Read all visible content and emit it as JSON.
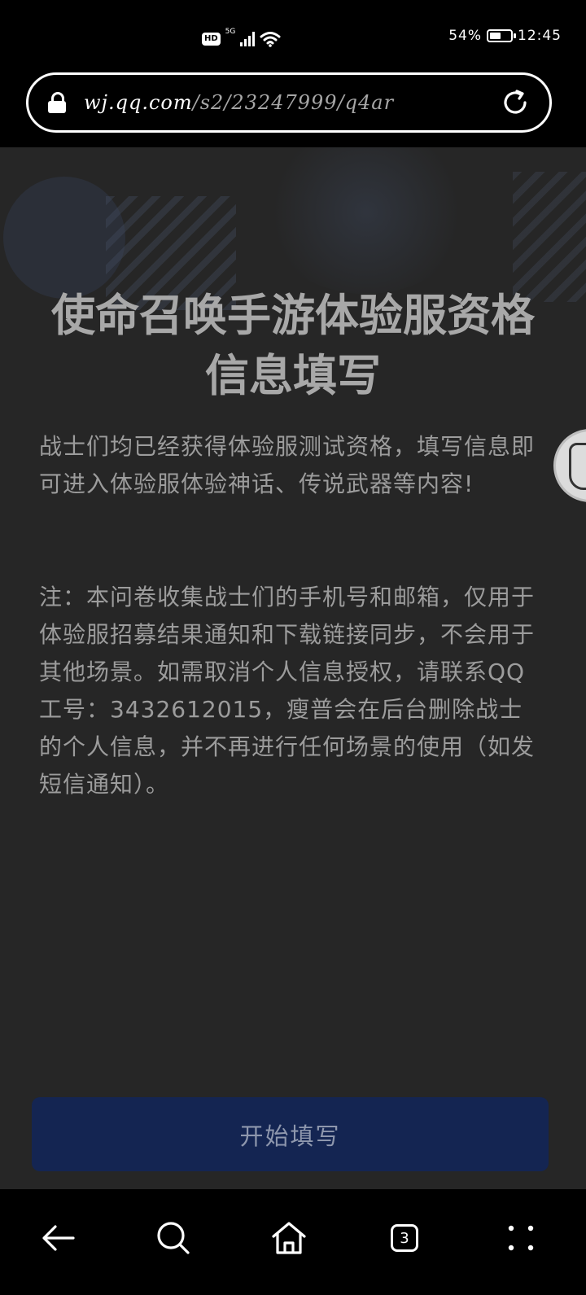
{
  "status_bar": {
    "hd": "HD",
    "network": "5G",
    "battery_text": "54%",
    "battery_level": 0.54,
    "time": "12:45"
  },
  "browser": {
    "url_host": "wj.qq.com",
    "url_path": "/s2/23247999/q4ar",
    "tab_count": "3"
  },
  "page": {
    "title_line1": "使命召唤手游体验服资格",
    "title_line2": "信息填写",
    "intro": "战士们均已经获得体验服测试资格，填写信息即可进入体验服体验神话、传说武器等内容!",
    "note": "注：本问卷收集战士们的手机号和邮箱，仅用于体验服招募结果通知和下载链接同步，不会用于其他场景。如需取消个人信息授权，请联系QQ工号：3432612015，瘦普会在后台删除战士的个人信息，并不再进行任何场景的使用（如发短信通知）。",
    "start_button": "开始填写"
  },
  "colors": {
    "page_bg": "#262626",
    "button_bg": "#142552",
    "text": "#9c9c9c"
  },
  "icons": {
    "back": "back-arrow-icon",
    "search": "search-icon",
    "home": "home-icon",
    "tabs": "tabs-icon",
    "menu": "menu-dots-icon"
  }
}
